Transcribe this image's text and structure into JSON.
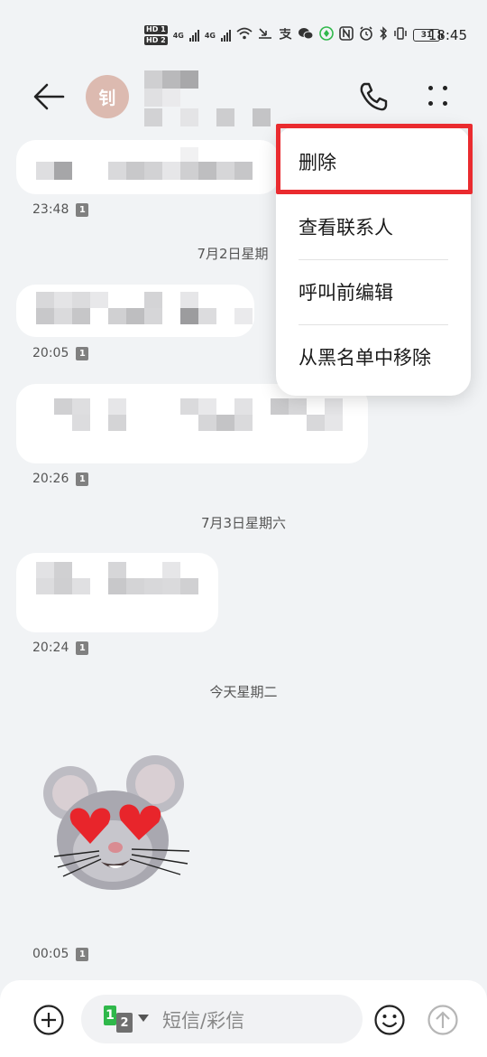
{
  "status_bar": {
    "hd1": "HD 1",
    "hd2": "HD 2",
    "net1": "4G",
    "net2": "4G",
    "battery": "31",
    "time": "18:45"
  },
  "header": {
    "avatar_initial": "钊"
  },
  "messages": [
    {
      "time": "23:48",
      "sim": "1"
    },
    {
      "time": "20:05",
      "sim": "1"
    },
    {
      "time": "20:26",
      "sim": "1"
    },
    {
      "time": "20:24",
      "sim": "1"
    },
    {
      "time": "00:05",
      "sim": "1"
    }
  ],
  "date_separators": [
    "7月2日星期",
    "7月3日星期六",
    "今天星期二"
  ],
  "menu": {
    "items": [
      "删除",
      "查看联系人",
      "呼叫前编辑",
      "从黑名单中移除"
    ]
  },
  "input": {
    "sim_primary": "1",
    "sim_secondary": "2",
    "placeholder": "短信/彩信"
  },
  "colors": {
    "highlight": "#ea2b2f",
    "avatar_bg": "#dcbab0",
    "sim_active": "#2fb84a"
  }
}
